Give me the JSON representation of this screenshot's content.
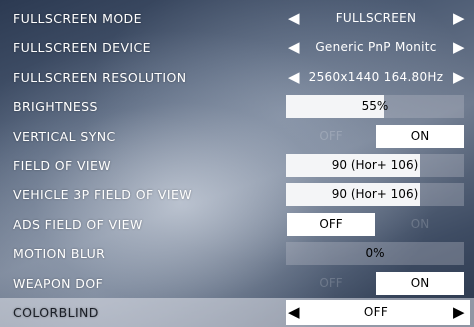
{
  "settings": {
    "fullscreen_mode": {
      "label": "FULLSCREEN MODE",
      "value": "FULLSCREEN"
    },
    "fullscreen_device": {
      "label": "FULLSCREEN DEVICE",
      "value": "Generic PnP Monitc"
    },
    "fullscreen_resolution": {
      "label": "FULLSCREEN RESOLUTION",
      "value": "2560x1440 164.80Hz"
    },
    "brightness": {
      "label": "BRIGHTNESS",
      "value": "55%",
      "fill": 0.55
    },
    "vertical_sync": {
      "label": "VERTICAL SYNC",
      "off": "OFF",
      "on": "ON",
      "selected": "ON"
    },
    "field_of_view": {
      "label": "FIELD OF VIEW",
      "value": "90 (Hor+ 106)",
      "fill": 0.75
    },
    "vehicle_3p_fov": {
      "label": "VEHICLE 3P FIELD OF VIEW",
      "value": "90 (Hor+ 106)",
      "fill": 0.75
    },
    "ads_field_of_view": {
      "label": "ADS FIELD OF VIEW",
      "off": "OFF",
      "on": "ON",
      "selected": "OFF"
    },
    "motion_blur": {
      "label": "MOTION BLUR",
      "value": "0%",
      "fill": 0.0
    },
    "weapon_dof": {
      "label": "WEAPON DOF",
      "off": "OFF",
      "on": "ON",
      "selected": "ON"
    },
    "colorblind": {
      "label": "COLORBLIND",
      "value": "OFF",
      "focused": true
    }
  },
  "icons": {
    "left": "chevron-left-icon",
    "right": "chevron-right-icon"
  }
}
